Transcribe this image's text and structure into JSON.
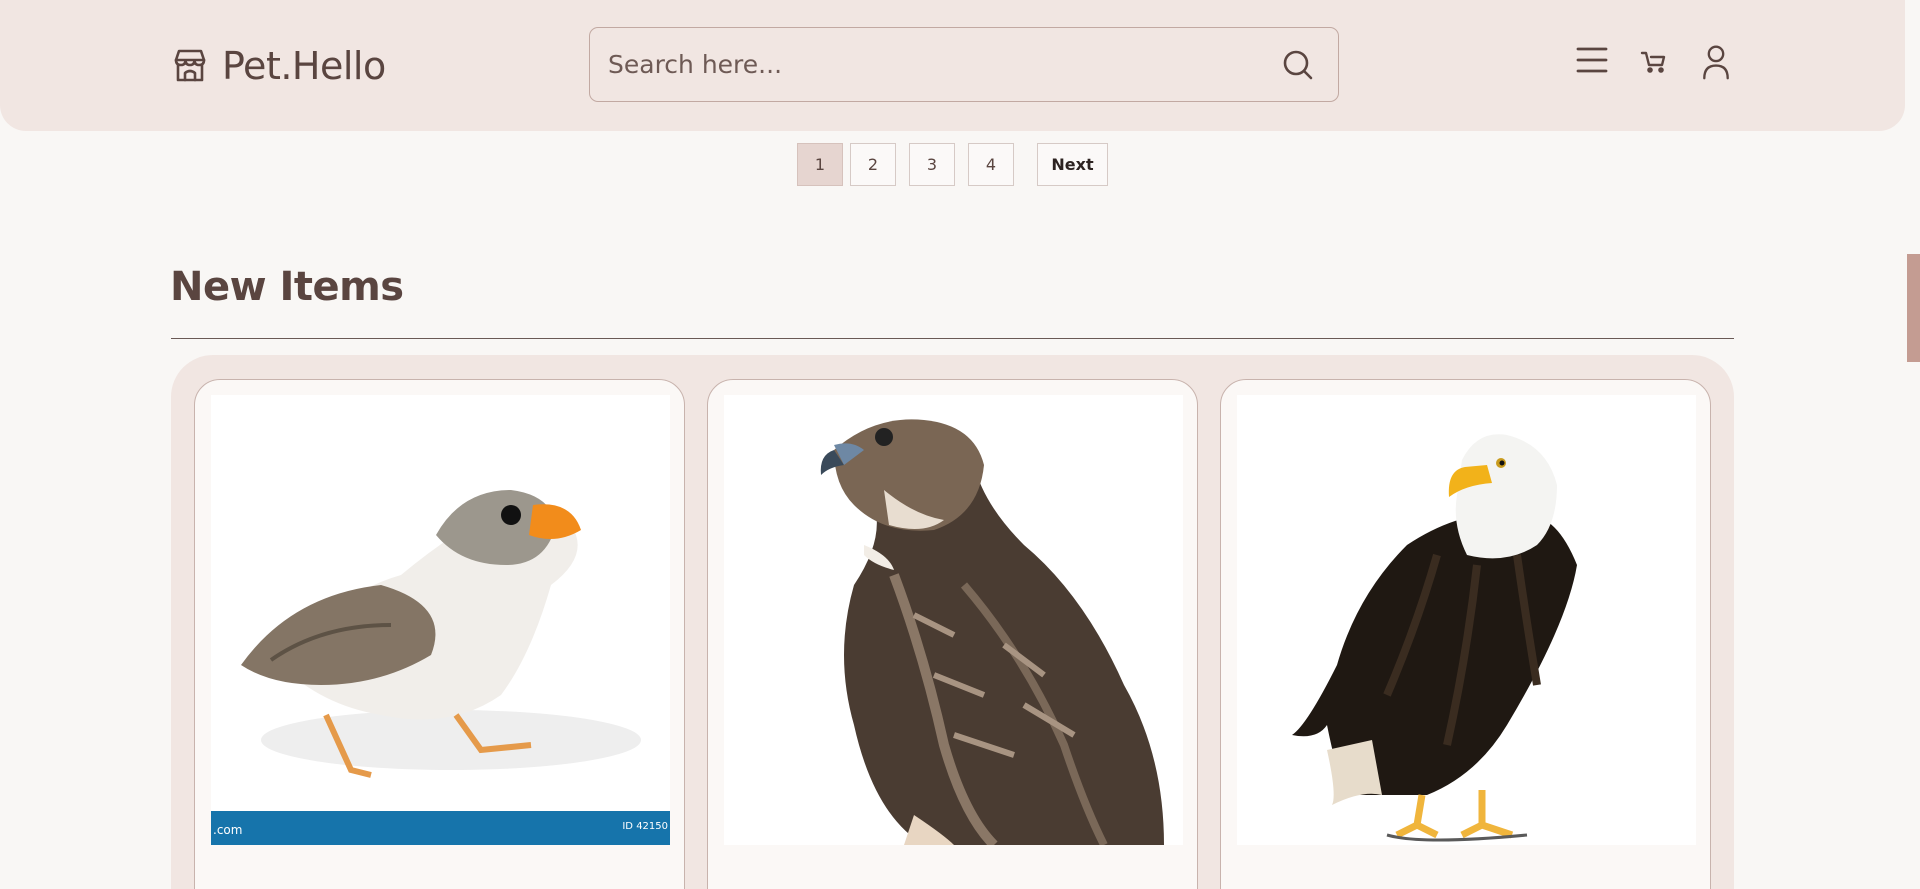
{
  "header": {
    "brand": "Pet.Hello",
    "search_placeholder": "Search here...",
    "icons": [
      "store-icon",
      "search-icon",
      "menu-icon",
      "cart-icon",
      "user-icon"
    ]
  },
  "pagination": {
    "pages": [
      "1",
      "2",
      "3",
      "4"
    ],
    "active_page": "1",
    "next_label": "Next"
  },
  "section": {
    "title": "New Items"
  },
  "cards": [
    {
      "image": "zebra-finch-photo",
      "watermark_left": ".com",
      "watermark_right": "ID 42150"
    },
    {
      "image": "red-tailed-hawk-photo"
    },
    {
      "image": "bald-eagle-photo"
    }
  ],
  "colors": {
    "header_bg": "#f1e6e2",
    "page_bg": "#f9f7f5",
    "text": "#5a4540",
    "active_page_bg": "#e6d5d0",
    "scroll_thumb": "#c49c92",
    "stock_bar": "#1674ab"
  }
}
